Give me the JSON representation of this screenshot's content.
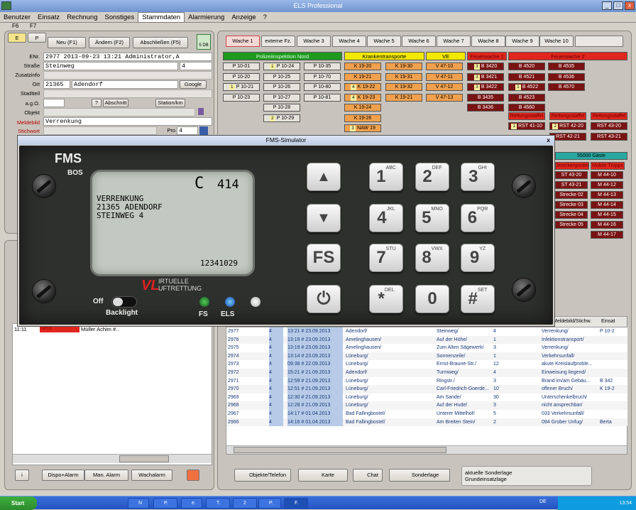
{
  "window": {
    "title": "ELS Professional"
  },
  "menu": [
    "Benutzer",
    "Einsatz",
    "Rechnung",
    "Sonstiges",
    "Stammdaten",
    "Alarmierung",
    "Anzeige",
    "?"
  ],
  "menu_active": "Stammdaten",
  "shortcuts": {
    "f6": "F6",
    "f7": "F7"
  },
  "left": {
    "tab_e": "E",
    "tab_p": "P",
    "buttons": {
      "new": "Neu (F1)",
      "edit": "Ändern (F2)",
      "close": "Abschließen (F5)"
    },
    "side_indicator": "5 DB",
    "labels": {
      "enr": "ENr.",
      "strasse": "Straße",
      "zusatz": "Zusatzinfo",
      "ort": "Ort",
      "stadtteil": "Stadtteil",
      "ago": "a.g.O.",
      "objekt": "Objekt",
      "meldebild": "Meldebild",
      "stichwort": "Stichwort"
    },
    "values": {
      "enr": "2977  2013-09-23 13:21  Administrator,A",
      "strasse": "Steinweg",
      "hausnr": "4",
      "plz": "21365",
      "ort": "Adendorf",
      "map": "Google",
      "meldebild": "Verrenkung",
      "pro": "Pro",
      "pro_num": "4"
    },
    "abschnitt": "Abschnitt",
    "station": "Station/km",
    "log": {
      "time": "11:11",
      "status": "Tiefrot",
      "text": "Müller Achim #.."
    },
    "bottom_buttons": {
      "info": "i",
      "dispo": "Dispo+Alarm",
      "manual": "Man. Alarm",
      "wache": "Wachalarm"
    }
  },
  "tabs": [
    "Wache 1",
    "externe Fz.",
    "Wache 3",
    "Wache 4",
    "Wache 5",
    "Wache 6",
    "Wache 7",
    "Wache 8",
    "Wache 9",
    "Wache 10"
  ],
  "groups": [
    {
      "label": "Polizeiinspektion Nord",
      "color": "#1f9a1f"
    },
    {
      "label": "Krankentransporte",
      "color": "#f2e800"
    },
    {
      "label": "VE",
      "color": "#f2e800"
    },
    {
      "label": "Feuerwache 1",
      "color": "#e0261d"
    },
    {
      "label": "Feuerwache 2",
      "color": "#e0261d"
    }
  ],
  "vehicles": {
    "police": [
      [
        "P 10-01",
        "P 10-24",
        "P 10-35"
      ],
      [
        "P 10-20",
        "P 10-25",
        "P 10-70"
      ],
      [
        "P 10-21",
        "P 10-26",
        "P 10-80"
      ],
      [
        "P 10-23",
        "P 10-27",
        "P 10-81"
      ],
      [
        "",
        "P 10-28",
        ""
      ],
      [
        "",
        "P 10-29",
        ""
      ]
    ],
    "police_badges": {
      "0-1": "1",
      "2-0": "1",
      "5-1": "2"
    },
    "ktw": [
      [
        "K 19-20",
        "K 19-30"
      ],
      [
        "K 19-21",
        "K 19-31"
      ],
      [
        "K 19-22",
        "K 19-32"
      ],
      [
        "K 19-23",
        "K 19-21"
      ],
      [
        "K 19-24",
        ""
      ],
      [
        "K 19-26",
        ""
      ],
      [
        "NAW 19",
        ""
      ]
    ],
    "ktw_badges": {
      "2-0": "4",
      "3-0": "4",
      "6-0": "3"
    },
    "ve": [
      "V 47-10",
      "V 47-11",
      "V 47-12",
      "V 47-13"
    ],
    "fw1": [
      "B 3420",
      "B 3421",
      "B 3422",
      "B 3435",
      "B 3436"
    ],
    "fw1_badges": [
      "3",
      "3",
      "3",
      "",
      ""
    ],
    "fw2": [
      [
        "B 4520",
        "B 4535"
      ],
      [
        "B 4521",
        "B 4536"
      ],
      [
        "B 4522",
        "B 4570"
      ],
      [
        "B 4523",
        ""
      ],
      [
        "B 4560",
        ""
      ]
    ],
    "fw2_badges": {
      "2-0": "1"
    },
    "rettung_headers": [
      "Rettungsstaffel",
      "Rettungsstaffel",
      "Rettungsstaffel"
    ],
    "rettung": [
      [
        "RST 41-10",
        "RST 42-20",
        "RST 43-20"
      ],
      [
        "",
        "RST 42-21",
        "RST 43-21"
      ]
    ],
    "rettung_badges": {
      "0-0": "1",
      "0-1": "2"
    },
    "gaeste": "55000 Gäste",
    "strecke_headers": [
      "Streckenposten",
      "Mobile Trupps"
    ],
    "strecke": [
      [
        "ST 43-20",
        "M 44-10"
      ],
      [
        "ST 43-21",
        "M 44-12"
      ],
      [
        "Strecke 02",
        "M 44-13"
      ],
      [
        "Strecke 03",
        "M 44-14"
      ],
      [
        "Strecke 04",
        "M 44-15"
      ],
      [
        "Strecke 05",
        "M 44-16"
      ],
      [
        "",
        "M 44-17"
      ]
    ]
  },
  "dialog": {
    "title": "FMS-Simulator",
    "close": "x",
    "brand": "FMS",
    "sub": "BOS",
    "lcd_status": "C",
    "lcd_code": "414",
    "lcd_lines": [
      "VERRENKUNG",
      "21365 ADENDORF",
      "STEINWEG 4"
    ],
    "lcd_id": "12341029",
    "logo_line1": "IRTUELLE",
    "logo_line2": "UFTRETTUNG",
    "logo_mark": "VL",
    "off_label": "Off",
    "backlight": "Backlight",
    "led_fs": "FS",
    "led_els": "ELS",
    "keys": {
      "fs": "FS",
      "k1": "1",
      "k1s": "ABC",
      "k2": "2",
      "k2s": "DEF",
      "k3": "3",
      "k3s": "GHI",
      "k4": "4",
      "k4s": "JKL",
      "k5": "5",
      "k5s": "MNO",
      "k6": "6",
      "k6s": "PQR",
      "k7": "7",
      "k7s": "STU",
      "k8": "8",
      "k8s": "VWX",
      "k9": "9",
      "k9s": "YZ",
      "kstar": "*",
      "kstars": "DEL",
      "k0": "0",
      "khash": "#",
      "khashs": "SET"
    }
  },
  "table": {
    "header_meldebild": "Meldebild/Stichw.",
    "header_einsatz": "Einsat",
    "rows": [
      [
        "2977",
        "4",
        "13:21 # 23.09.2013",
        "Adendorf/",
        "Steinweg/",
        "4",
        "Verrenkung/",
        "P 10-2"
      ],
      [
        "2976",
        "4",
        "13:19 # 23.09.2013",
        "Amelinghausen/",
        "Auf der Höhe/",
        "1",
        "Infektionstransport/",
        ""
      ],
      [
        "2975",
        "4",
        "13:19 # 23.09.2013",
        "Amelinghausen/",
        "Zum Alten Sägewerk/",
        "3",
        "Verrenkung/",
        ""
      ],
      [
        "2974",
        "4",
        "13:14 # 23.09.2013",
        "Lüneburg/",
        "Sonnenzeile/",
        "1",
        "Verkehrsunfall/",
        ""
      ],
      [
        "2973",
        "4",
        "09:38 # 22.09.2013",
        "Lüneburg/",
        "Ernst-Braune-Str./",
        "12",
        "akute Kreislaufproble...",
        ""
      ],
      [
        "2972",
        "4",
        "15:21 # 21.09.2013",
        "Adendorf/",
        "Turmweg/",
        "4",
        "Einweisung liegend/",
        ""
      ],
      [
        "2971",
        "4",
        "12:59 # 21.09.2013",
        "Lüneburg/",
        "Ringstr./",
        "3",
        "Brand im/am Gebäu...",
        "B 342"
      ],
      [
        "2970",
        "4",
        "12:51 # 21.09.2013",
        "Lüneburg/",
        "Carl-Friedrich-Goerde...",
        "10",
        "offener Bruch/",
        "K 19-2"
      ],
      [
        "2969",
        "4",
        "12:30 # 21.09.2013",
        "Lüneburg/",
        "Am Sande/",
        "30",
        "Unterschenkelbruch/",
        ""
      ],
      [
        "2968",
        "4",
        "12:28 # 21.09.2013",
        "Lüneburg/",
        "Auf der Hude/",
        "3",
        "nicht ansprechbar/",
        ""
      ],
      [
        "2967",
        "4",
        "14:17 # 01.04.2013",
        "Bad Fallingbostel/",
        "Unterer Mittelhof/",
        "5",
        "033 Verkehrsunfall/",
        ""
      ],
      [
        "2966",
        "4",
        "14:16 # 01.04.2013",
        "Bad Fallingbostel/",
        "Am Breiten Stein/",
        "2",
        "094 Grober Unfug/",
        "Berta"
      ]
    ]
  },
  "bottom_buttons": {
    "objekte": "Objekte/Telefon",
    "karte": "Karte",
    "chat": "Chat",
    "sonderlage": "Sonderlage"
  },
  "sonderlage": {
    "line1": "aktuelle Sonderlage",
    "line2": "Grundeinsatzlage"
  },
  "taskbar": {
    "start": "Start",
    "tasks": [
      "N",
      "P.",
      "e.",
      "T.",
      "2",
      "P.",
      "F."
    ],
    "lang": "DE",
    "clock": "13:54"
  }
}
